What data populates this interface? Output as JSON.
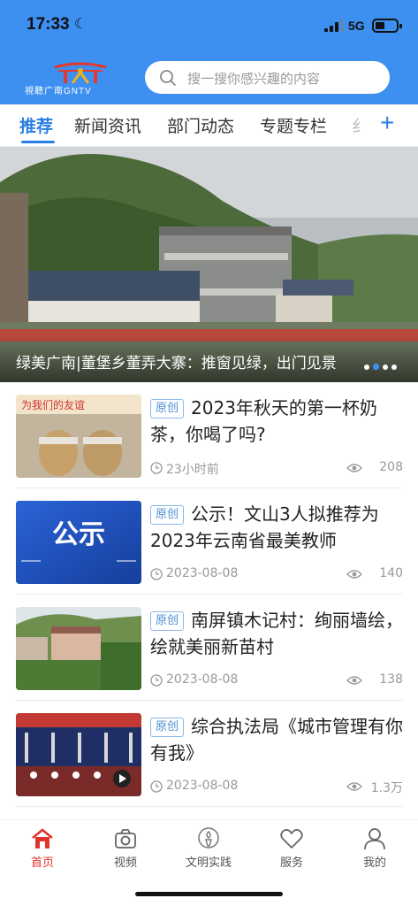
{
  "status_bar": {
    "time": "17:33",
    "network": "5G"
  },
  "header": {
    "logo_text": "視聽广南GNTV",
    "search_placeholder": "搜一搜你感兴趣的内容"
  },
  "tabs": [
    {
      "label": "推荐",
      "active": true
    },
    {
      "label": "新闻资讯",
      "active": false
    },
    {
      "label": "部门动态",
      "active": false
    },
    {
      "label": "专题专栏",
      "active": false
    }
  ],
  "banner": {
    "title": "绿美广南|董堡乡董弄大寨：推窗见绿，出门见景",
    "dot_count": 4,
    "active_dot": 0
  },
  "news": [
    {
      "badge": "原创",
      "title": "2023年秋天的第一杯奶茶，你喝了吗?",
      "time": "23小时前",
      "views": "208",
      "thumb_text": "为我们的友谊"
    },
    {
      "badge": "原创",
      "title": "公示！文山3人拟推荐为2023年云南省最美教师",
      "time": "2023-08-08",
      "views": "140",
      "thumb_text": "公示"
    },
    {
      "badge": "原创",
      "title": "南屏镇木记村：绚丽墙绘，绘就美丽新苗村",
      "time": "2023-08-08",
      "views": "138"
    },
    {
      "badge": "原创",
      "title": "综合执法局《城市管理有你有我》",
      "time": "2023-08-08",
      "views": "1.3万"
    }
  ],
  "bottom_nav": [
    {
      "label": "首页",
      "icon": "home-icon",
      "active": true
    },
    {
      "label": "视频",
      "icon": "camera-icon",
      "active": false
    },
    {
      "label": "文明实践",
      "icon": "torch-icon",
      "active": false
    },
    {
      "label": "服务",
      "icon": "heart-icon",
      "active": false
    },
    {
      "label": "我的",
      "icon": "user-icon",
      "active": false
    }
  ],
  "colors": {
    "brand_blue": "#3d8ff0",
    "tab_active": "#2a7fe3",
    "nav_active": "#e0332a"
  }
}
